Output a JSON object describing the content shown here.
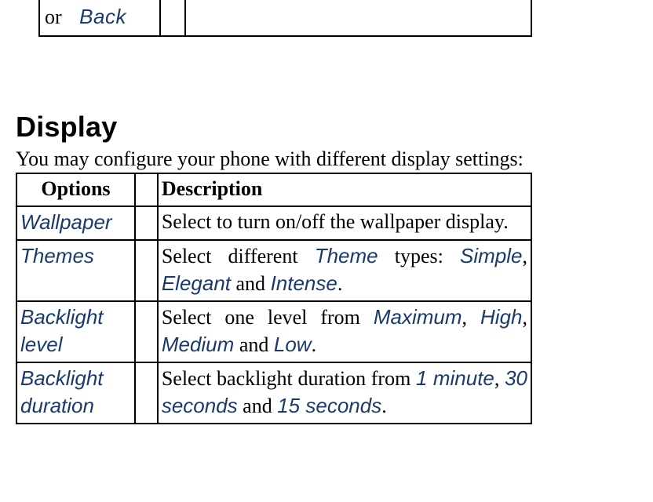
{
  "top": {
    "or_text": "or",
    "back_label": "Back"
  },
  "section": {
    "heading": "Display",
    "intro": "You may configure your phone with different display settings:"
  },
  "table": {
    "head_options": "Options",
    "head_description": "Description",
    "rows": [
      {
        "option": "Wallpaper",
        "desc_plain": "Select to turn on/off the wallpaper display."
      },
      {
        "option": "Themes",
        "desc_lead": "Select different ",
        "term1": "Theme",
        "mid1": " types: ",
        "term2": "Simple",
        "sep1": ", ",
        "term3": "Elegant",
        "mid2": " and ",
        "term4": "Intense",
        "tail": "."
      },
      {
        "option": "Backlight level",
        "desc_lead": "Select one level from ",
        "term1": "Maximum",
        "sep1": ", ",
        "term2": "High",
        "sep2": ", ",
        "term3": "Medium",
        "mid2": " and ",
        "term4": "Low",
        "tail": "."
      },
      {
        "option": "Backlight duration",
        "desc_lead": "Select backlight duration from ",
        "term1": "1 minute",
        "sep1": ", ",
        "term2": "30 seconds",
        "mid2": " and ",
        "term3": "15 seconds",
        "tail": "."
      }
    ]
  }
}
